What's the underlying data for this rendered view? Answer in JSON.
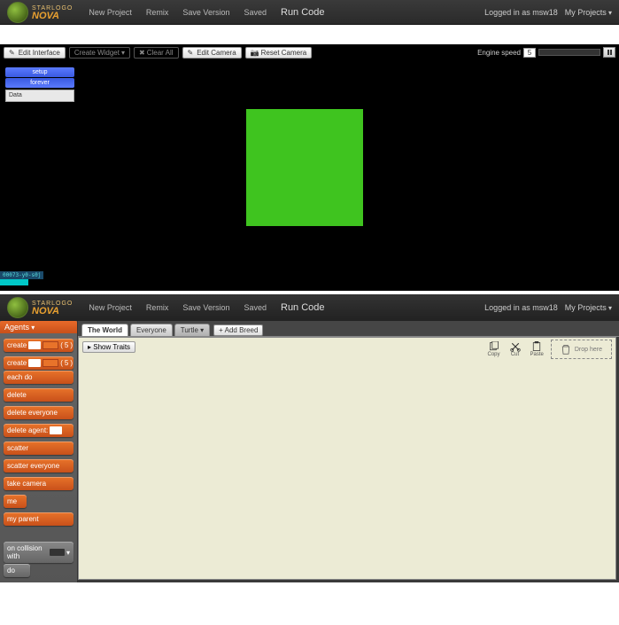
{
  "brand": {
    "line1": "STARLOGO",
    "line2": "NOVA"
  },
  "nav": {
    "new_project": "New Project",
    "remix": "Remix",
    "save_version": "Save Version",
    "saved": "Saved",
    "run_code": "Run Code",
    "logged_in": "Logged in as msw18",
    "my_projects": "My Projects"
  },
  "toolbar": {
    "edit_interface": "Edit Interface",
    "create_widget": "Create Widget",
    "clear_all": "Clear All",
    "edit_camera": "Edit Camera",
    "reset_camera": "Reset Camera",
    "engine_speed_label": "Engine speed",
    "engine_speed_value": "5"
  },
  "widgets": {
    "setup": "setup",
    "forever": "forever",
    "data_label": "Data"
  },
  "status": {
    "id": "00073-y0-s0j"
  },
  "drawer": {
    "title": "Agents",
    "blocks": {
      "create": "create",
      "create_do": "create",
      "each_do": "each do",
      "delete": "delete",
      "delete_everyone": "delete everyone",
      "delete_agent": "delete agent:",
      "scatter": "scatter",
      "scatter_everyone": "scatter everyone",
      "take_camera": "take camera",
      "me": "me",
      "my_parent": "my parent",
      "on_collision": "on collision with",
      "do": "do"
    },
    "counts": {
      "create": "5",
      "create_do": "5"
    }
  },
  "tabs": {
    "world": "The World",
    "everyone": "Everyone",
    "turtle": "Turtle",
    "add_breed": "Add Breed"
  },
  "canvas": {
    "show_traits": "Show Traits",
    "copy": "Copy",
    "cut": "Cut",
    "paste": "Paste",
    "trash": "Drop here"
  }
}
